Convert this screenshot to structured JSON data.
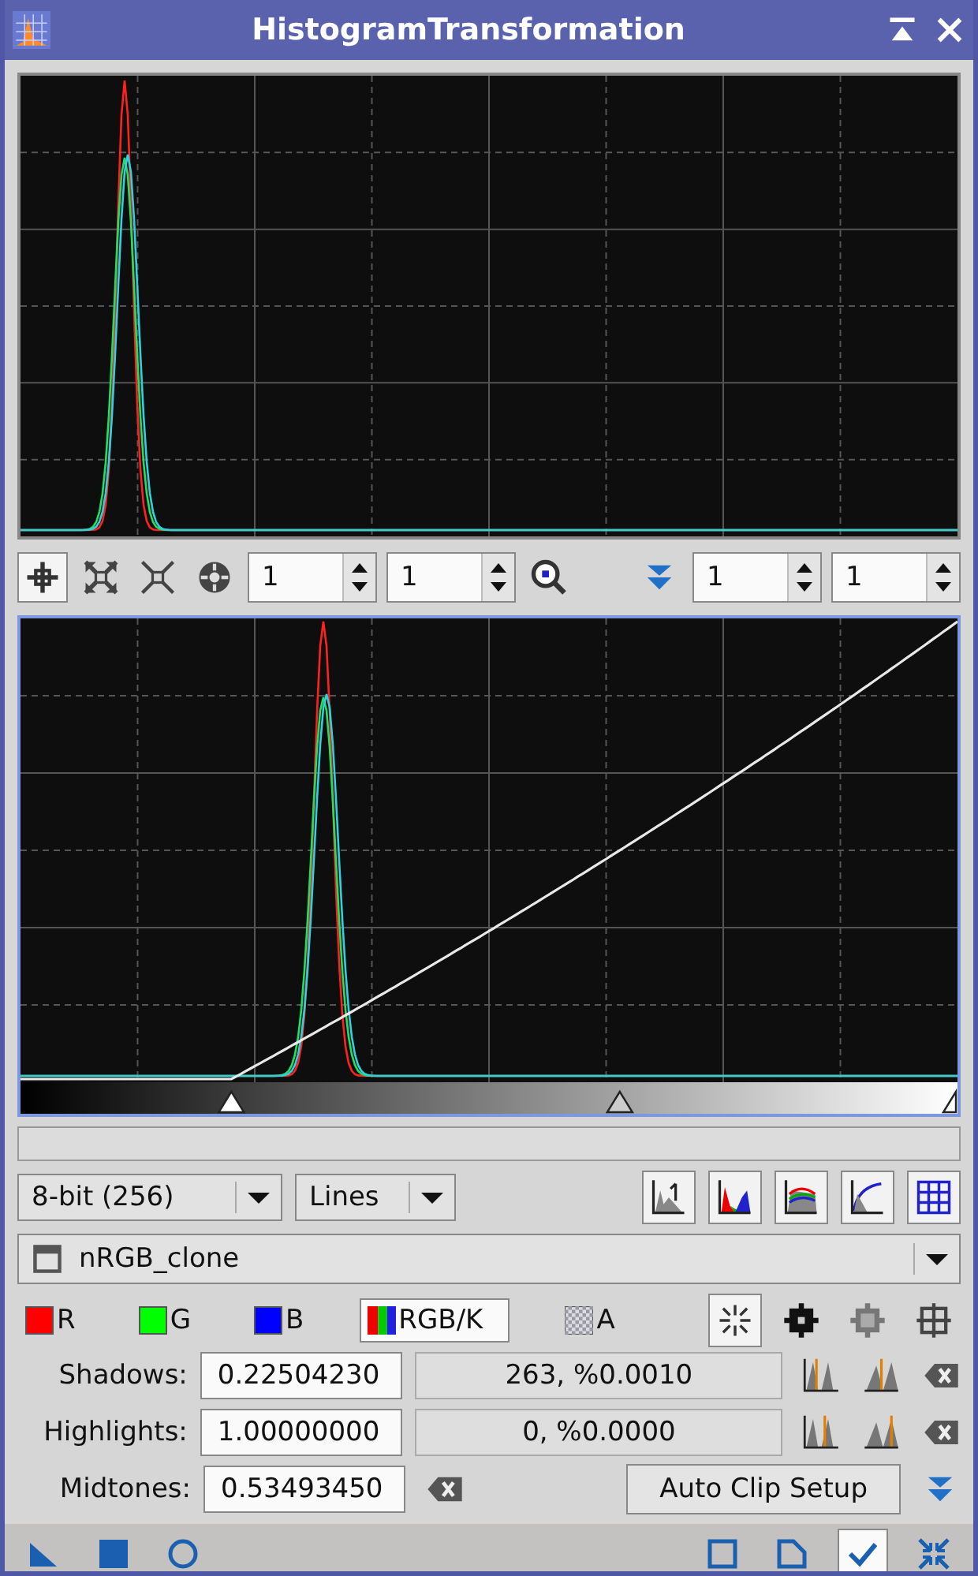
{
  "window": {
    "title": "HistogramTransformation"
  },
  "zoom_fields": [
    {
      "value": "1"
    },
    {
      "value": "1"
    },
    {
      "value": "1"
    },
    {
      "value": "1"
    }
  ],
  "resolution": {
    "value": "8-bit (256)"
  },
  "graph_style": {
    "value": "Lines"
  },
  "view": {
    "value": "nRGB_clone"
  },
  "channels": [
    {
      "label": "R",
      "kind": "color",
      "color": "#ff0000",
      "selected": false
    },
    {
      "label": "G",
      "kind": "color",
      "color": "#00ff00",
      "selected": false
    },
    {
      "label": "B",
      "kind": "color",
      "color": "#0000ff",
      "selected": false
    },
    {
      "label": "RGB/K",
      "kind": "rgb",
      "selected": true
    },
    {
      "label": "A",
      "kind": "alpha",
      "selected": false
    }
  ],
  "shadows": {
    "label": "Shadows:",
    "value": "0.22504230",
    "readout": "263, %0.0010"
  },
  "highlights": {
    "label": "Highlights:",
    "value": "1.00000000",
    "readout": "0, %0.0000"
  },
  "midtones": {
    "label": "Midtones:",
    "value": "0.53493450"
  },
  "auto_clip_button": "Auto Clip Setup"
}
